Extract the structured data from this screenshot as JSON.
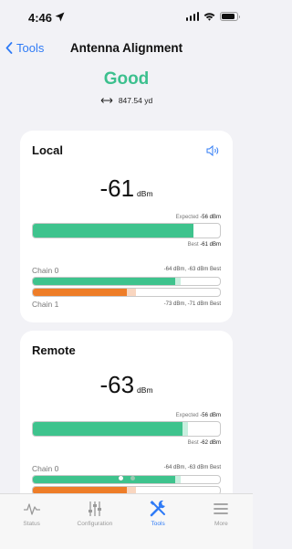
{
  "status_bar": {
    "time": "4:46"
  },
  "nav": {
    "back_label": "Tools",
    "title": "Antenna Alignment"
  },
  "quality": "Good",
  "distance": "847.54 yd",
  "local": {
    "title": "Local",
    "value": "-61",
    "unit": "dBm",
    "expected_label": "Expected",
    "expected_value": "-56 dBm",
    "best_label": "Best",
    "best_value": "-61 dBm",
    "signal_fraction": 0.86,
    "best_fraction": 0.86,
    "chains": [
      {
        "label": "Chain 0",
        "info": "-64 dBm, -63 dBm Best",
        "fill_fraction": 0.76,
        "best_fraction": 0.79,
        "color": "#3ec38d"
      },
      {
        "label": "Chain 1",
        "info": "-73 dBm, -71 dBm Best",
        "fill_fraction": 0.5,
        "best_fraction": 0.55,
        "color": "#ee7d28"
      }
    ]
  },
  "remote": {
    "title": "Remote",
    "value": "-63",
    "unit": "dBm",
    "expected_label": "Expected",
    "expected_value": "-56 dBm",
    "best_label": "Best",
    "best_value": "-62 dBm",
    "signal_fraction": 0.8,
    "best_fraction": 0.83,
    "chains": [
      {
        "label": "Chain 0",
        "info": "-64 dBm, -63 dBm Best",
        "fill_fraction": 0.76,
        "best_fraction": 0.79,
        "color": "#3ec38d"
      },
      {
        "label": "",
        "info": "",
        "fill_fraction": 0.5,
        "best_fraction": 0.55,
        "color": "#ee7d28"
      }
    ]
  },
  "page_dots": {
    "count": 2,
    "active": 0
  },
  "tabs": [
    {
      "label": "Status",
      "icon": "status-waveform-icon",
      "active": false
    },
    {
      "label": "Configuration",
      "icon": "sliders-icon",
      "active": false
    },
    {
      "label": "Tools",
      "icon": "tools-icon",
      "active": true
    },
    {
      "label": "More",
      "icon": "more-menu-icon",
      "active": false
    }
  ],
  "colors": {
    "accent": "#2f7bf6",
    "good": "#3cc08e",
    "signal_green": "#3ec38d",
    "signal_orange": "#ee7d28"
  }
}
